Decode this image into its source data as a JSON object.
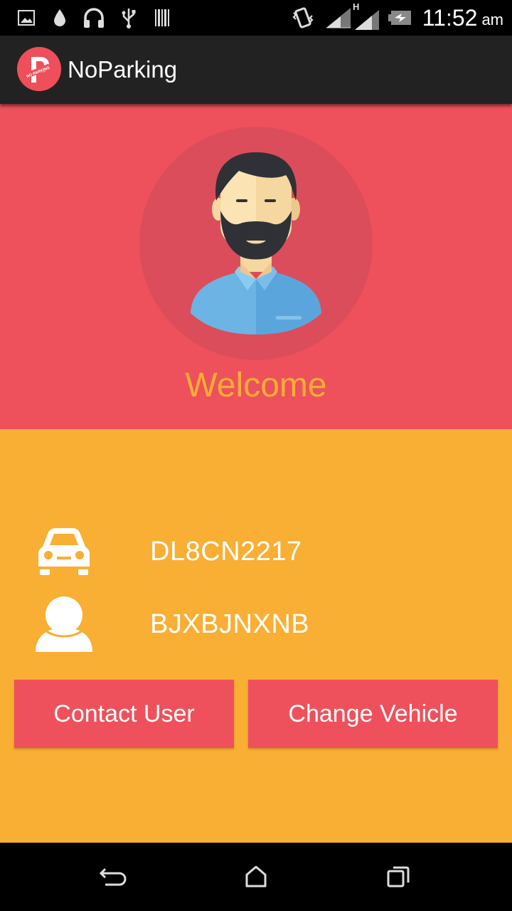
{
  "status_bar": {
    "time": "11:52",
    "ampm": "am",
    "network_label": "H",
    "icons": [
      "image-icon",
      "water-drop-icon",
      "headset-icon",
      "usb-icon",
      "barcode-icon",
      "vibrate-icon",
      "signal-icon",
      "signal-h-icon",
      "battery-charging-icon"
    ]
  },
  "app_bar": {
    "title": "NoParking",
    "logo_icon": "noparking-logo-icon",
    "logo_text": "NO PARKING"
  },
  "header": {
    "welcome": "Welcome",
    "avatar_icon": "bearded-man-avatar-icon"
  },
  "details": {
    "vehicle_number": "DL8CN2217",
    "vehicle_icon": "car-icon",
    "user_name": "BJXBJNXNB",
    "user_icon": "person-icon"
  },
  "actions": {
    "contact_user": "Contact User",
    "change_vehicle": "Change Vehicle"
  },
  "navigation": {
    "back_icon": "back-icon",
    "home_icon": "home-icon",
    "recents_icon": "recents-icon"
  },
  "colors": {
    "primary_red": "#ee515c",
    "accent_orange": "#f9ae34",
    "app_bar": "#222222"
  }
}
